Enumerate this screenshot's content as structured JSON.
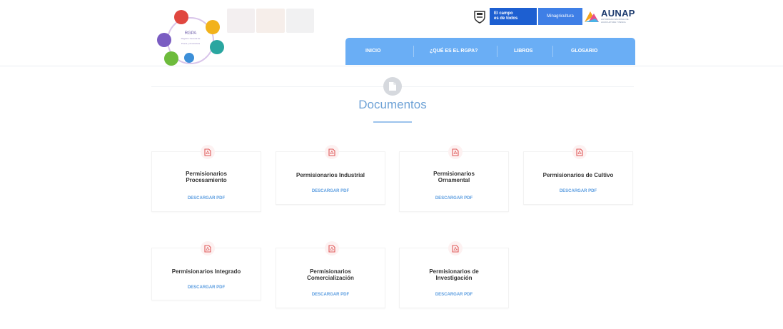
{
  "logo": {
    "name": "RGPA",
    "tagline": "Registro General de Pesca y Acuicultura"
  },
  "header": {
    "campo_line1": "El campo",
    "campo_line2": "es de todos",
    "ministry": "Minagricultura",
    "aunap_title": "AUNAP",
    "aunap_subtitle": "AUTORIDAD NACIONAL DE ACUICULTURA Y PESCA"
  },
  "nav": {
    "items": [
      {
        "label": "INICIO"
      },
      {
        "label": "¿QUÉ ES EL RGPA?"
      },
      {
        "label": "LIBROS"
      },
      {
        "label": "GLOSARIO"
      }
    ]
  },
  "section": {
    "title": "Documentos"
  },
  "cards": [
    {
      "title_line1": "Permisionarios",
      "title_line2": "Procesamiento",
      "link": "DESCARGAR PDF"
    },
    {
      "title_line1": "Permisionarios Industrial",
      "title_line2": "",
      "link": "DESCARGAR PDF"
    },
    {
      "title_line1": "Permisionarios",
      "title_line2": "Ornamental",
      "link": "DESCARGAR PDF"
    },
    {
      "title_line1": "Permisionarios de Cultivo",
      "title_line2": "",
      "link": "DESCARGAR PDF"
    },
    {
      "title_line1": "Permisionarios Integrado",
      "title_line2": "",
      "link": "DESCARGAR PDF"
    },
    {
      "title_line1": "Permisionarios",
      "title_line2": "Comercialización",
      "link": "DESCARGAR PDF"
    },
    {
      "title_line1": "Permisionarios de",
      "title_line2": "Investigación",
      "link": "DESCARGAR PDF"
    }
  ],
  "icons": {
    "card_icon": "pdf-icon",
    "section_icon": "document-icon"
  },
  "colors": {
    "nav_blue": "#6aaef5",
    "title_blue": "#6ea2d6",
    "link_blue": "#5b9de0",
    "pdf_red": "#e05a5a"
  }
}
